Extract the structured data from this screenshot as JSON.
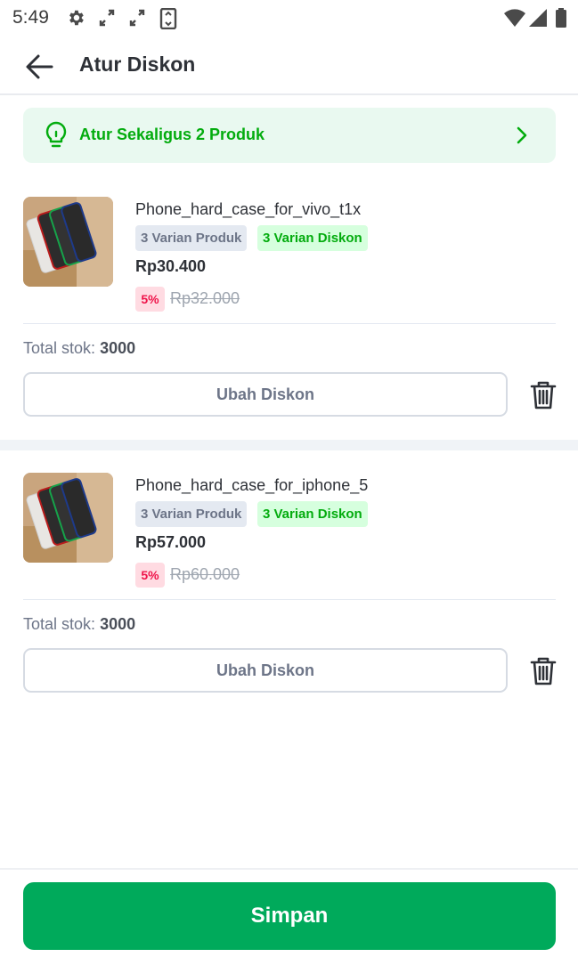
{
  "status_bar": {
    "time": "5:49",
    "icons": [
      "gear-icon",
      "expand-icon",
      "expand-icon",
      "app-icon",
      "wifi-icon",
      "signal-icon",
      "battery-icon"
    ]
  },
  "app_bar": {
    "title": "Atur Diskon",
    "back_icon": "arrow-left-icon"
  },
  "banner": {
    "label": "Atur Sekaligus 2 Produk",
    "icon": "lightbulb-icon",
    "accent": "#03ac0e"
  },
  "products": [
    {
      "name": "Phone_hard_case_for_vivo_t1x",
      "variant_tag": "3 Varian Produk",
      "discount_tag": "3 Varian Diskon",
      "price": "Rp30.400",
      "discount_percent": "5%",
      "original_price": "Rp32.000",
      "stock_label": "Total stok:",
      "stock_value": "3000",
      "edit_label": "Ubah Diskon"
    },
    {
      "name": "Phone_hard_case_for_iphone_5",
      "variant_tag": "3 Varian Produk",
      "discount_tag": "3 Varian Diskon",
      "price": "Rp57.000",
      "discount_percent": "5%",
      "original_price": "Rp60.000",
      "stock_label": "Total stok:",
      "stock_value": "3000",
      "edit_label": "Ubah Diskon"
    }
  ],
  "footer": {
    "save_label": "Simpan",
    "save_color": "#00aa5b"
  }
}
